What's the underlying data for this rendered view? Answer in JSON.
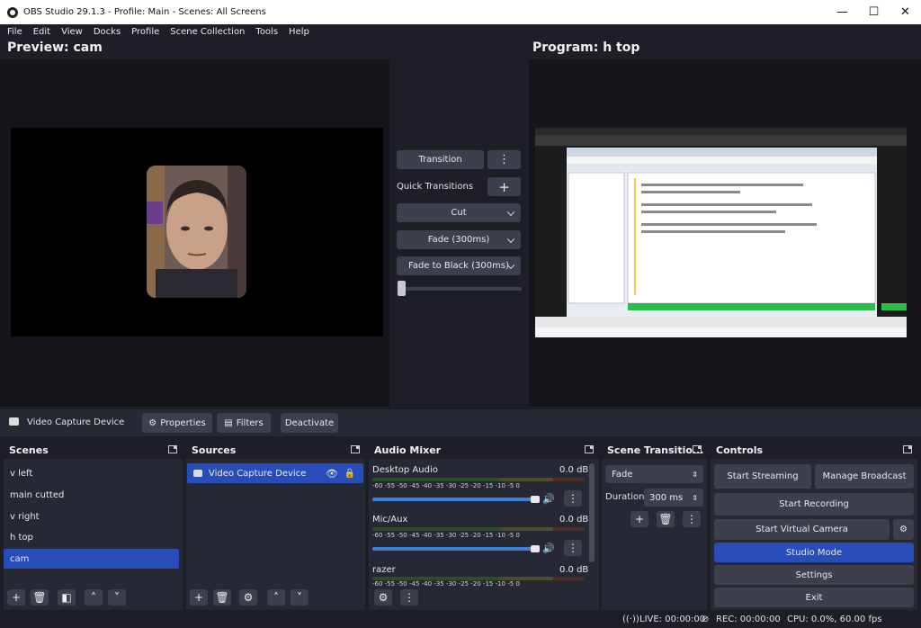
{
  "window": {
    "title": "OBS Studio 29.1.3 - Profile: Main - Scenes: All Screens",
    "minimize": "—",
    "maximize": "☐",
    "close": "✕"
  },
  "menu": [
    "File",
    "Edit",
    "View",
    "Docks",
    "Profile",
    "Scene Collection",
    "Tools",
    "Help"
  ],
  "preview": {
    "title": "Preview: cam"
  },
  "program": {
    "title": "Program: h top"
  },
  "transitions": {
    "transition_label": "Transition",
    "quick_label": "Quick Transitions",
    "cut": "Cut",
    "fade": "Fade (300ms)",
    "fade_black": "Fade to Black (300ms)",
    "more": "⋮",
    "add": "+"
  },
  "sourcebar": {
    "source_name": "Video Capture Device",
    "properties": "Properties",
    "filters": "Filters",
    "deactivate": "Deactivate"
  },
  "scenes": {
    "title": "Scenes",
    "items": [
      "v left",
      "main cutted",
      "v right",
      "h top",
      "cam"
    ],
    "active_index": 4
  },
  "sources": {
    "title": "Sources",
    "items": [
      "Video Capture Device"
    ]
  },
  "mixer": {
    "title": "Audio Mixer",
    "channels": [
      {
        "name": "Desktop Audio",
        "db": "0.0 dB"
      },
      {
        "name": "Mic/Aux",
        "db": "0.0 dB"
      },
      {
        "name": "razer",
        "db": "0.0 dB"
      }
    ],
    "scale": "-60 -55 -50 -45 -40 -35 -30 -25 -20 -15 -10 -5 0"
  },
  "scene_transitions": {
    "title": "Scene Transitio...",
    "type": "Fade",
    "duration_label": "Duration",
    "duration_value": "300 ms"
  },
  "controls": {
    "title": "Controls",
    "start_streaming": "Start Streaming",
    "manage_broadcast": "Manage Broadcast",
    "start_recording": "Start Recording",
    "start_virtual_camera": "Start Virtual Camera",
    "studio_mode": "Studio Mode",
    "settings": "Settings",
    "exit": "Exit"
  },
  "status": {
    "live": "LIVE: 00:00:00",
    "rec": "REC: 00:00:00",
    "cpu": "CPU: 0.0%, 60.00 fps"
  },
  "colors": {
    "accent": "#284cb8",
    "background": "#1e1f26",
    "panel": "#262833",
    "button": "#3c404d"
  }
}
